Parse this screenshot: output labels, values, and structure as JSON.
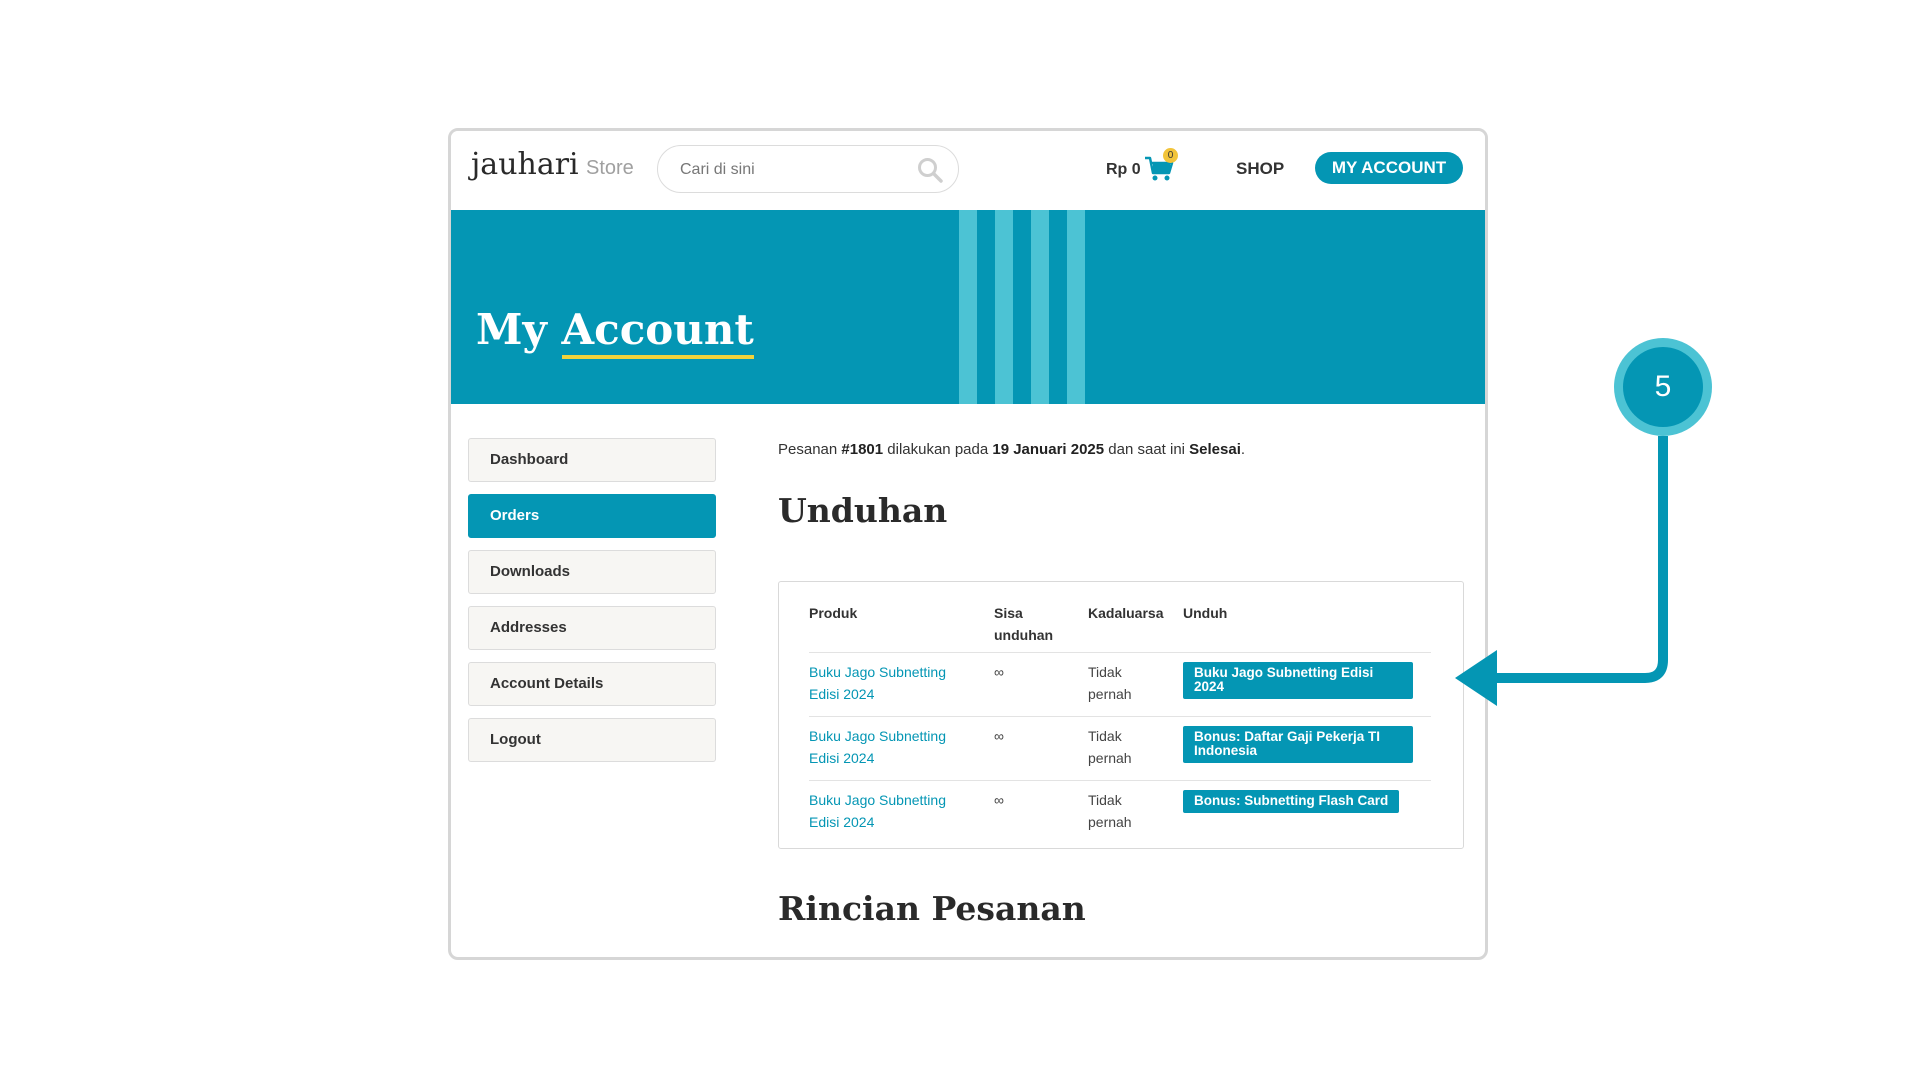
{
  "header": {
    "logo_main": "jauhari",
    "logo_sub": "Store",
    "search_placeholder": "Cari di sini",
    "cart_amount": "Rp 0",
    "cart_count": "0",
    "nav_shop": "SHOP",
    "nav_account": "MY ACCOUNT"
  },
  "banner": {
    "title_part1": "My",
    "title_part2": "Account"
  },
  "sidebar": {
    "items": [
      {
        "label": "Dashboard",
        "active": false
      },
      {
        "label": "Orders",
        "active": true
      },
      {
        "label": "Downloads",
        "active": false
      },
      {
        "label": "Addresses",
        "active": false
      },
      {
        "label": "Account Details",
        "active": false
      },
      {
        "label": "Logout",
        "active": false
      }
    ]
  },
  "order": {
    "prefix": "Pesanan ",
    "number": "#1801",
    "mid1": " dilakukan pada ",
    "date": "19 Januari 2025",
    "mid2": " dan saat ini ",
    "status": "Selesai",
    "suffix": "."
  },
  "downloads": {
    "heading": "Unduhan",
    "columns": [
      "Produk",
      "Sisa unduhan",
      "Kadaluarsa",
      "Unduh"
    ],
    "rows": [
      {
        "product": "Buku Jago Subnetting Edisi 2024",
        "remaining": "∞",
        "expires": "Tidak pernah",
        "button": "Buku Jago Subnetting Edisi 2024"
      },
      {
        "product": "Buku Jago Subnetting Edisi 2024",
        "remaining": "∞",
        "expires": "Tidak pernah",
        "button": "Bonus: Daftar Gaji Pekerja TI Indonesia"
      },
      {
        "product": "Buku Jago Subnetting Edisi 2024",
        "remaining": "∞",
        "expires": "Tidak pernah",
        "button": "Bonus: Subnetting Flash Card"
      }
    ]
  },
  "details": {
    "heading": "Rincian Pesanan"
  },
  "callout": {
    "number": "5"
  },
  "colors": {
    "accent": "#0496b4",
    "accent_light": "#4cc3d4",
    "underline": "#f2d33c"
  }
}
